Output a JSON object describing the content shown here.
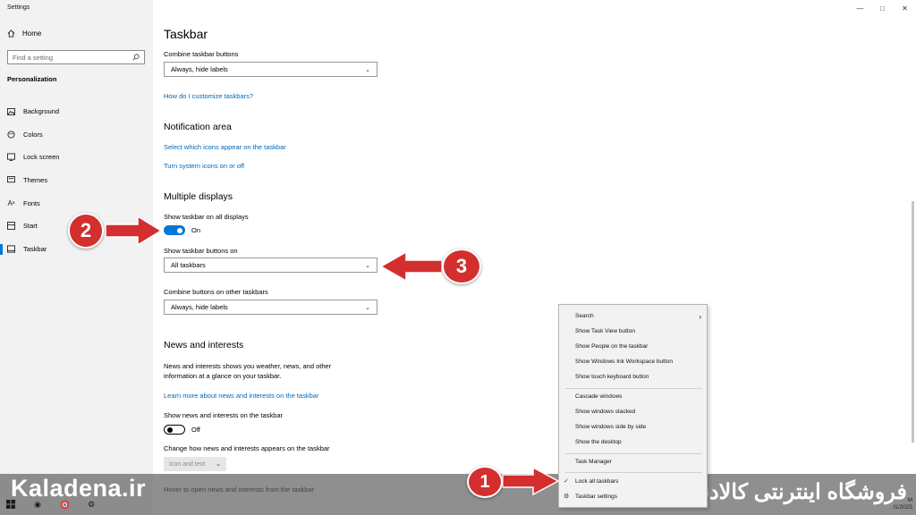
{
  "window": {
    "title": "Settings",
    "minimize": "—",
    "maximize": "□",
    "close": "✕"
  },
  "sidebar": {
    "home": "Home",
    "search_placeholder": "Find a setting",
    "section": "Personalization",
    "items": [
      {
        "label": "Background",
        "icon": "image-icon"
      },
      {
        "label": "Colors",
        "icon": "palette-icon"
      },
      {
        "label": "Lock screen",
        "icon": "lock-screen-icon"
      },
      {
        "label": "Themes",
        "icon": "brush-icon"
      },
      {
        "label": "Fonts",
        "icon": "font-icon"
      },
      {
        "label": "Start",
        "icon": "start-icon"
      },
      {
        "label": "Taskbar",
        "icon": "taskbar-icon",
        "active": true
      }
    ]
  },
  "main": {
    "title": "Taskbar",
    "combine_label": "Combine taskbar buttons",
    "combine_value": "Always, hide labels",
    "customize_link": "How do I customize taskbars?",
    "notification_heading": "Notification area",
    "select_icons_link": "Select which icons appear on the taskbar",
    "system_icons_link": "Turn system icons on or off",
    "multi_heading": "Multiple displays",
    "show_all_label": "Show taskbar on all displays",
    "show_all_toggle": "On",
    "show_buttons_label": "Show taskbar buttons on",
    "show_buttons_value": "All taskbars",
    "combine_other_label": "Combine buttons on other taskbars",
    "combine_other_value": "Always, hide labels",
    "news_heading": "News and interests",
    "news_desc": "News and interests shows you weather, news, and other information at a glance on your taskbar.",
    "news_link": "Learn more about news and interests on the taskbar",
    "news_show_label": "Show news and interests on the taskbar",
    "news_toggle": "Off",
    "news_change_label": "Change how news and interests appears on the taskbar",
    "news_change_value": "Icon and text",
    "news_hover": "Hover to open news and interests from the taskbar"
  },
  "context_menu": {
    "items": [
      "Search",
      "Show Task View button",
      "Show People on the taskbar",
      "Show Windows Ink Workspace button",
      "Show touch keyboard button",
      "Cascade windows",
      "Show windows stacked",
      "Show windows side by side",
      "Show the desktop",
      "Task Manager",
      "Lock all taskbars",
      "Taskbar settings"
    ]
  },
  "annotations": {
    "one": "1",
    "two": "2",
    "three": "3",
    "color": "#d32f2f"
  },
  "watermark": {
    "left": "Kaladena.ir",
    "right": "فروشگاه اینترنتی کالادنا"
  },
  "clock": {
    "time": "M",
    "date": "/1/2025"
  },
  "colors": {
    "accent": "#0078d7",
    "link": "#0067b8"
  }
}
